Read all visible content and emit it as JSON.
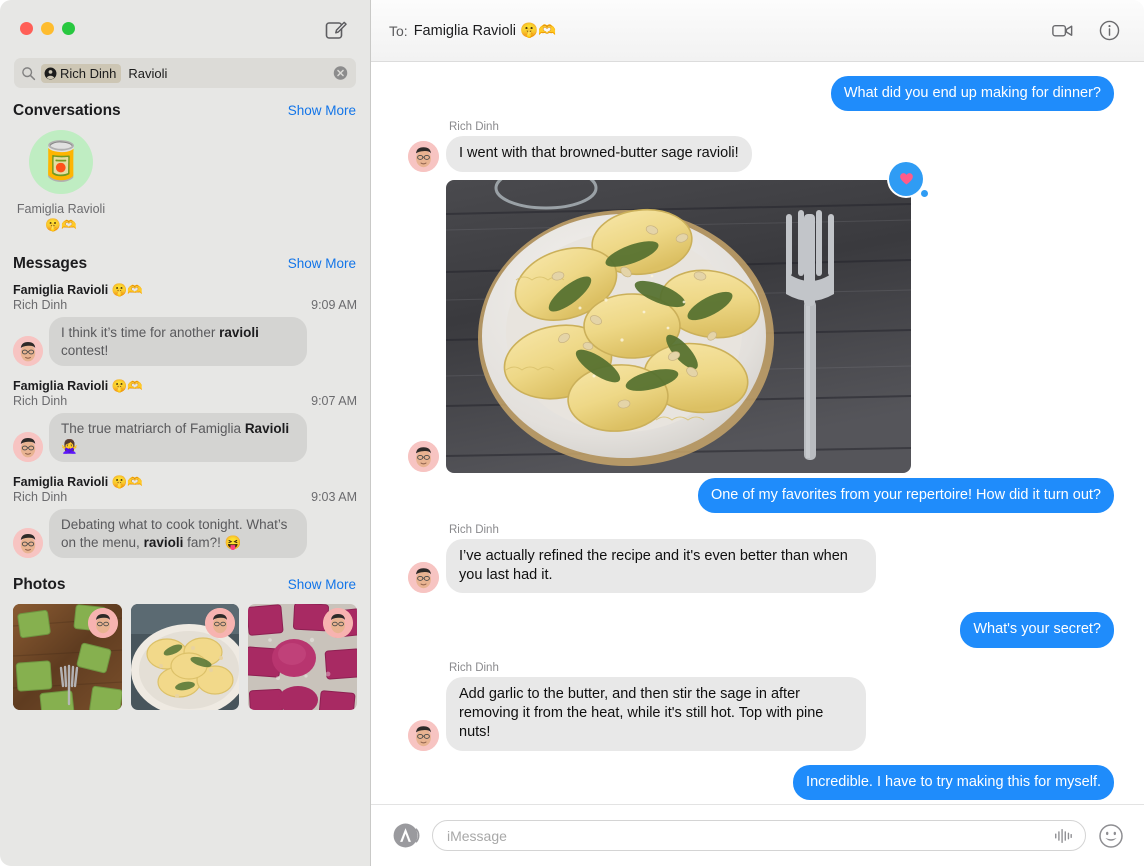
{
  "window": {
    "traffic_lights": [
      "close",
      "minimize",
      "zoom"
    ],
    "compose_icon": "compose-icon"
  },
  "search": {
    "icon": "search-icon",
    "token_icon": "person-circle-icon",
    "token_label": "Rich Dinh",
    "query_text": "Ravioli",
    "clear_icon": "clear-icon",
    "placeholder": "Search"
  },
  "sidebar": {
    "sections": {
      "conversations": {
        "title": "Conversations",
        "show_more": "Show More",
        "items": [
          {
            "avatar_emoji": "🥫",
            "avatar_color": "#bfedc2",
            "name": "Famiglia Ravioli 🤫🫶"
          }
        ]
      },
      "messages": {
        "title": "Messages",
        "show_more": "Show More",
        "items": [
          {
            "thread": "Famiglia Ravioli 🤫🫶",
            "sender": "Rich Dinh",
            "time": "9:09 AM",
            "preview_pre": "I think it’s time for another ",
            "preview_hl": "ravioli",
            "preview_post": " contest!"
          },
          {
            "thread": "Famiglia Ravioli 🤫🫶",
            "sender": "Rich Dinh",
            "time": "9:07 AM",
            "preview_pre": "The true matriarch of Famiglia ",
            "preview_hl": "Ravioli",
            "preview_post": " 🙅‍♀️"
          },
          {
            "thread": "Famiglia Ravioli 🤫🫶",
            "sender": "Rich Dinh",
            "time": "9:03 AM",
            "preview_pre": "Debating what to cook tonight. What’s on the menu, ",
            "preview_hl": "ravioli",
            "preview_post": " fam?! 😝"
          }
        ]
      },
      "photos": {
        "title": "Photos",
        "show_more": "Show More",
        "items": [
          {
            "alt": "green spinach ravioli on wooden board with fork"
          },
          {
            "alt": "yellow ravioli with sage on plate"
          },
          {
            "alt": "magenta beet ravioli dusted with flour"
          }
        ]
      }
    }
  },
  "conversation": {
    "to_label": "To:",
    "to_name": "Famiglia Ravioli 🤫🫶",
    "facetime_icon": "video-camera-icon",
    "info_icon": "info-circle-icon",
    "messages": [
      {
        "side": "out",
        "text": "What did you end up making for dinner?"
      },
      {
        "side": "in",
        "sender": "Rich Dinh",
        "text": "I went with that browned-butter sage ravioli!"
      },
      {
        "side": "in",
        "type": "photo",
        "alt": "plate of browned-butter sage ravioli with pine nuts on dark wood table with fork",
        "reaction": "❤️"
      },
      {
        "side": "out",
        "text": "One of my favorites from your repertoire! How did it turn out?"
      },
      {
        "side": "in",
        "sender": "Rich Dinh",
        "text": "I’ve actually refined the recipe and it's even better than when you last had it."
      },
      {
        "side": "out",
        "text": "What's your secret?"
      },
      {
        "side": "in",
        "sender": "Rich Dinh",
        "text": "Add garlic to the butter, and then stir the sage in after removing it from the heat, while it's still hot. Top with pine nuts!"
      },
      {
        "side": "out",
        "text": "Incredible. I have to try making this for myself."
      }
    ]
  },
  "composer": {
    "apps_icon": "app-store-icon",
    "placeholder": "iMessage",
    "value": "",
    "audio_icon": "audio-waveform-icon",
    "emoji_icon": "smiley-face-icon"
  },
  "colors": {
    "imessage_blue": "#1f8cfb",
    "bubble_grey": "#e8e8e8",
    "sidebar_bg": "#e7e7e5",
    "link_blue": "#1375e8",
    "tapback_blue": "#2f9cf4",
    "heart_pink": "#ff5c8a"
  }
}
